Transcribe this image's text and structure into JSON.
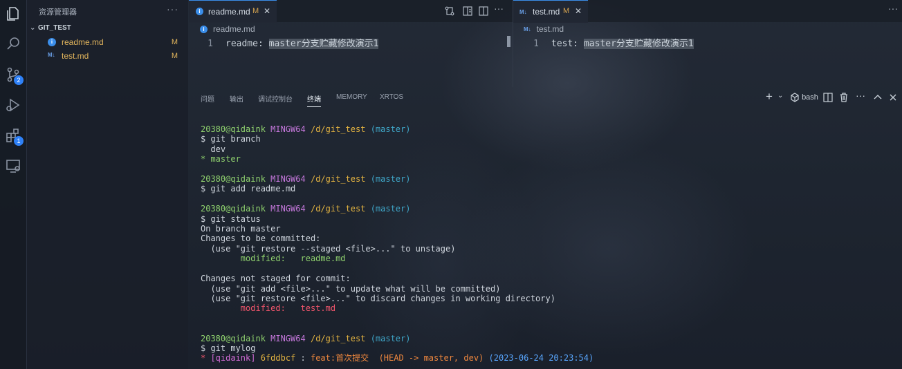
{
  "sidebar": {
    "title": "资源管理器",
    "more": "···",
    "folder": "GIT_TEST",
    "files": [
      {
        "name": "readme.md",
        "status": "M",
        "icon": "info-icon"
      },
      {
        "name": "test.md",
        "status": "M",
        "icon": "markdown-icon"
      }
    ]
  },
  "activity": {
    "source_control_badge": "2",
    "extensions_badge": "1"
  },
  "editor_left": {
    "tab_label": "readme.md",
    "tab_modified": "M",
    "tab_close": "✕",
    "breadcrumb": "readme.md",
    "line_number": "1",
    "line_prefix": "readme: ",
    "line_highlight": "master分支贮藏修改演示1",
    "more": "···"
  },
  "editor_right": {
    "tab_label": "test.md",
    "tab_modified": "M",
    "tab_close": "✕",
    "breadcrumb": "test.md",
    "line_number": "1",
    "line_prefix": "test: ",
    "line_highlight": "master分支贮藏修改演示1",
    "md_icon_text": "M↓"
  },
  "window_more": "···",
  "panel": {
    "tabs": [
      "问题",
      "输出",
      "调试控制台",
      "终端",
      "MEMORY",
      "XRTOS"
    ],
    "active_tab": "终端",
    "add": "+",
    "shell_label": "bash"
  },
  "terminal": {
    "user": "20380@qidaink",
    "env": "MINGW64",
    "path": "/d/git_test",
    "branch": "(master)",
    "cmd1": "$ git branch",
    "branch_dev": "  dev",
    "branch_master": "* master",
    "cmd2": "$ git add readme.md",
    "cmd3": "$ git status",
    "on_branch": "On branch master",
    "to_commit": "Changes to be committed:",
    "hint_unstage": "  (use \"git restore --staged <file>...\" to unstage)",
    "staged_file": "        modified:   readme.md",
    "not_staged": "Changes not staged for commit:",
    "hint_add": "  (use \"git add <file>...\" to update what will be committed)",
    "hint_restore": "  (use \"git restore <file>...\" to discard changes in working directory)",
    "unstaged_file": "        modified:   test.md",
    "cmd4": "$ git mylog",
    "log_star": "* ",
    "log_author": "[qidaink]",
    "log_hash": "6fddbcf",
    "log_sep": " : ",
    "log_msg": "feat:首次提交",
    "log_refs": "(HEAD -> master, dev)",
    "log_date": "(2023-06-24 20:23:54)"
  }
}
